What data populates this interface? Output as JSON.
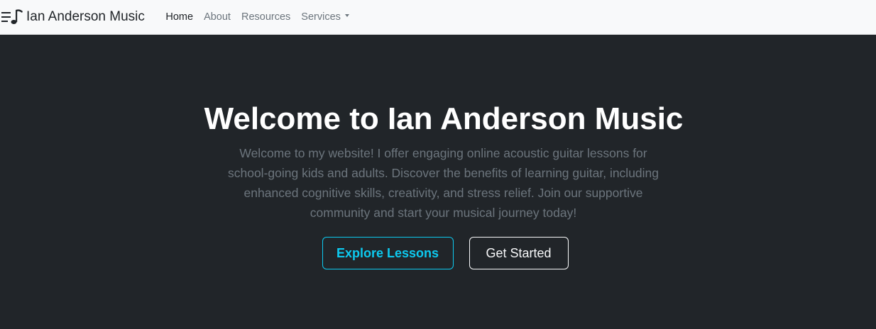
{
  "navbar": {
    "brand_icon": "music-playlist-icon",
    "brand_text": "Ian Anderson Music",
    "links": [
      {
        "label": "Home",
        "active": true
      },
      {
        "label": "About",
        "active": false
      },
      {
        "label": "Resources",
        "active": false
      },
      {
        "label": "Services",
        "active": false,
        "dropdown": true
      }
    ]
  },
  "hero": {
    "title": "Welcome to Ian Anderson Music",
    "lead": "Welcome to my website! I offer engaging online acoustic guitar lessons for school-going kids and adults. Discover the benefits of learning guitar, including enhanced cognitive skills, creativity, and stress relief. Join our supportive community and start your musical journey today!",
    "buttons": {
      "primary_label": "Explore Lessons",
      "secondary_label": "Get Started"
    }
  },
  "colors": {
    "navbar_bg": "#f8f9fa",
    "hero_bg": "#212529",
    "accent_info": "#0dcaf0",
    "muted_text": "#6c757d"
  }
}
